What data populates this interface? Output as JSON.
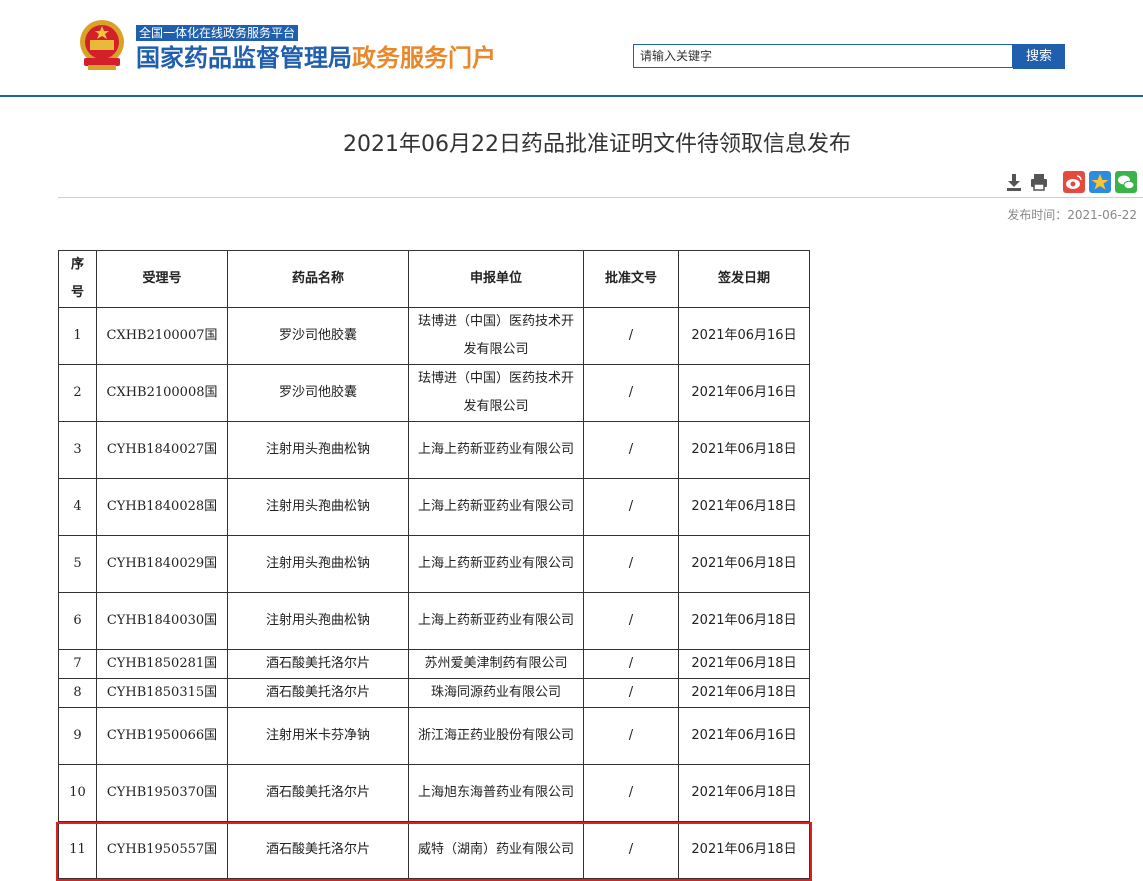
{
  "header": {
    "platform_tag": "全国一体化在线政务服务平台",
    "brand_blue": "国家药品监督管理局",
    "brand_orange": "政务服务门户",
    "search_placeholder": "请输入关键字",
    "search_button": "搜索"
  },
  "article": {
    "title": "2021年06月22日药品批准证明文件待领取信息发布",
    "publish_label": "发布时间：",
    "publish_date": "2021-06-22",
    "tools": [
      "download-icon",
      "print-icon",
      "weibo-icon",
      "qzone-icon",
      "wechat-icon"
    ]
  },
  "table": {
    "headers": [
      "序号",
      "受理号",
      "药品名称",
      "申报单位",
      "批准文号",
      "签发日期"
    ],
    "rows": [
      [
        "1",
        "CXHB2100007国",
        "罗沙司他胶囊",
        "珐博进（中国）医药技术开发有限公司",
        "/",
        "2021年06月16日"
      ],
      [
        "2",
        "CXHB2100008国",
        "罗沙司他胶囊",
        "珐博进（中国）医药技术开发有限公司",
        "/",
        "2021年06月16日"
      ],
      [
        "3",
        "CYHB1840027国",
        "注射用头孢曲松钠",
        "上海上药新亚药业有限公司",
        "/",
        "2021年06月18日"
      ],
      [
        "4",
        "CYHB1840028国",
        "注射用头孢曲松钠",
        "上海上药新亚药业有限公司",
        "/",
        "2021年06月18日"
      ],
      [
        "5",
        "CYHB1840029国",
        "注射用头孢曲松钠",
        "上海上药新亚药业有限公司",
        "/",
        "2021年06月18日"
      ],
      [
        "6",
        "CYHB1840030国",
        "注射用头孢曲松钠",
        "上海上药新亚药业有限公司",
        "/",
        "2021年06月18日"
      ],
      [
        "7",
        "CYHB1850281国",
        "酒石酸美托洛尔片",
        "苏州爱美津制药有限公司",
        "/",
        "2021年06月18日"
      ],
      [
        "8",
        "CYHB1850315国",
        "酒石酸美托洛尔片",
        "珠海同源药业有限公司",
        "/",
        "2021年06月18日"
      ],
      [
        "9",
        "CYHB1950066国",
        "注射用米卡芬净钠",
        "浙江海正药业股份有限公司",
        "/",
        "2021年06月16日"
      ],
      [
        "10",
        "CYHB1950370国",
        "酒石酸美托洛尔片",
        "上海旭东海普药业有限公司",
        "/",
        "2021年06月18日"
      ],
      [
        "11",
        "CYHB1950557国",
        "酒石酸美托洛尔片",
        "威特（湖南）药业有限公司",
        "/",
        "2021年06月18日"
      ]
    ],
    "highlighted_row": 11
  },
  "colors": {
    "brand_blue": "#1f5fae",
    "brand_orange": "#e8882a",
    "highlight_red": "#e02020"
  }
}
